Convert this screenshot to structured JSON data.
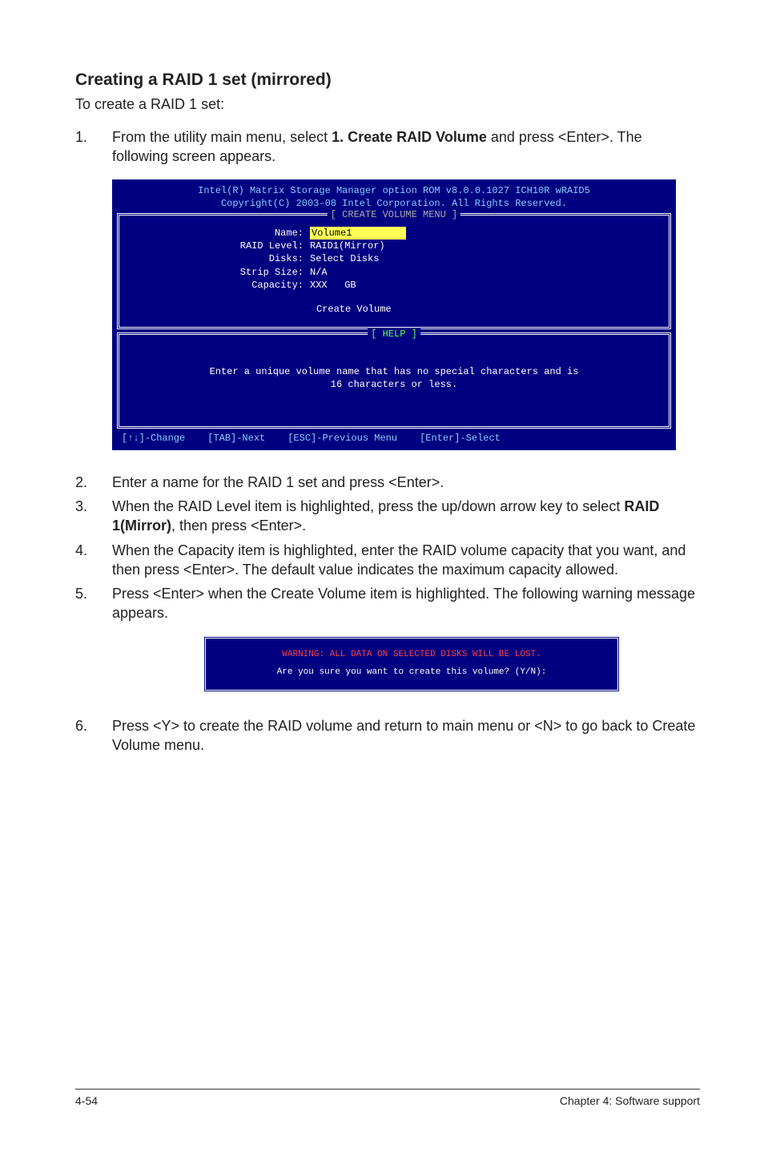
{
  "heading": "Creating a RAID 1 set (mirrored)",
  "intro": "To create a RAID 1 set:",
  "steps_a": {
    "s1": {
      "num": "1.",
      "pre": "From the utility main menu, select ",
      "bold": "1. Create RAID Volume",
      "post": " and press <Enter>. The following screen appears."
    }
  },
  "bios": {
    "head1": "Intel(R) Matrix Storage Manager option ROM v8.0.0.1027 ICH10R wRAID5",
    "head2": "Copyright(C) 2003-08 Intel Corporation. All Rights Reserved.",
    "frame1_title": "[ CREATE VOLUME MENU ]",
    "rows": {
      "name_label": "Name:",
      "name_value": "Volume1",
      "raid_label": "RAID Level:",
      "raid_value": "RAID1(Mirror)",
      "disks_label": "Disks:",
      "disks_value": "Select Disks",
      "strip_label": "Strip Size:",
      "strip_value": "N/A",
      "cap_label": "Capacity:",
      "cap_value": "XXX   GB"
    },
    "create": "Create Volume",
    "frame2_title": "[ HELP ]",
    "help_line1": "Enter a unique volume name that has no special characters and is",
    "help_line2": "16 characters or less.",
    "foot_change": "[↑↓]-Change",
    "foot_next": "[TAB]-Next",
    "foot_prev": "[ESC]-Previous Menu",
    "foot_select": "[Enter]-Select"
  },
  "steps_b": {
    "s2": {
      "num": "2.",
      "text": "Enter a name for the RAID 1 set and press <Enter>."
    },
    "s3": {
      "num": "3.",
      "pre": "When the RAID Level item is highlighted, press the up/down arrow key to select ",
      "bold": "RAID 1(Mirror)",
      "post": ", then press <Enter>."
    },
    "s4": {
      "num": "4.",
      "text": "When the Capacity item is highlighted, enter the RAID volume capacity that you want, and then press <Enter>. The default value indicates the maximum capacity allowed."
    },
    "s5": {
      "num": "5.",
      "text": "Press <Enter> when the Create Volume item is highlighted. The following warning message appears."
    }
  },
  "warning": {
    "red": "WARNING: ALL DATA ON SELECTED DISKS WILL BE LOST.",
    "white": "Are you sure you want to create this volume? (Y/N):"
  },
  "steps_c": {
    "s6": {
      "num": "6.",
      "text": "Press <Y> to create the RAID volume and return to main menu or <N> to go back to Create Volume menu."
    }
  },
  "footer": {
    "left": "4-54",
    "right": "Chapter 4: Software support"
  }
}
